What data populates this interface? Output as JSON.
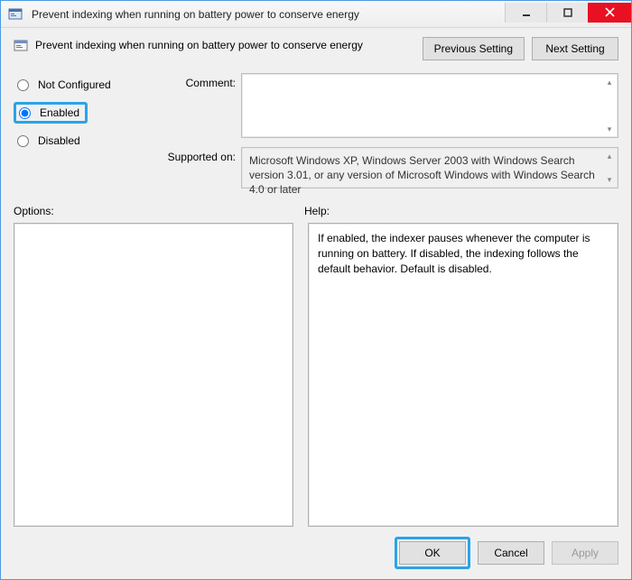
{
  "window": {
    "title": "Prevent indexing when running on battery power to conserve energy"
  },
  "header": {
    "policy_title": "Prevent indexing when running on battery power to conserve energy",
    "previous_setting": "Previous Setting",
    "next_setting": "Next Setting"
  },
  "state": {
    "not_configured_label": "Not Configured",
    "enabled_label": "Enabled",
    "disabled_label": "Disabled",
    "selected": "enabled"
  },
  "form": {
    "comment_label": "Comment:",
    "comment_value": "",
    "supported_label": "Supported on:",
    "supported_value": "Microsoft Windows XP, Windows Server 2003 with Windows Search version 3.01, or any version of Microsoft Windows with Windows Search 4.0 or later"
  },
  "sections": {
    "options_label": "Options:",
    "help_label": "Help:",
    "help_text": "If enabled, the indexer pauses whenever the computer is running on battery. If disabled, the indexing follows the default behavior. Default is disabled."
  },
  "footer": {
    "ok": "OK",
    "cancel": "Cancel",
    "apply": "Apply"
  }
}
